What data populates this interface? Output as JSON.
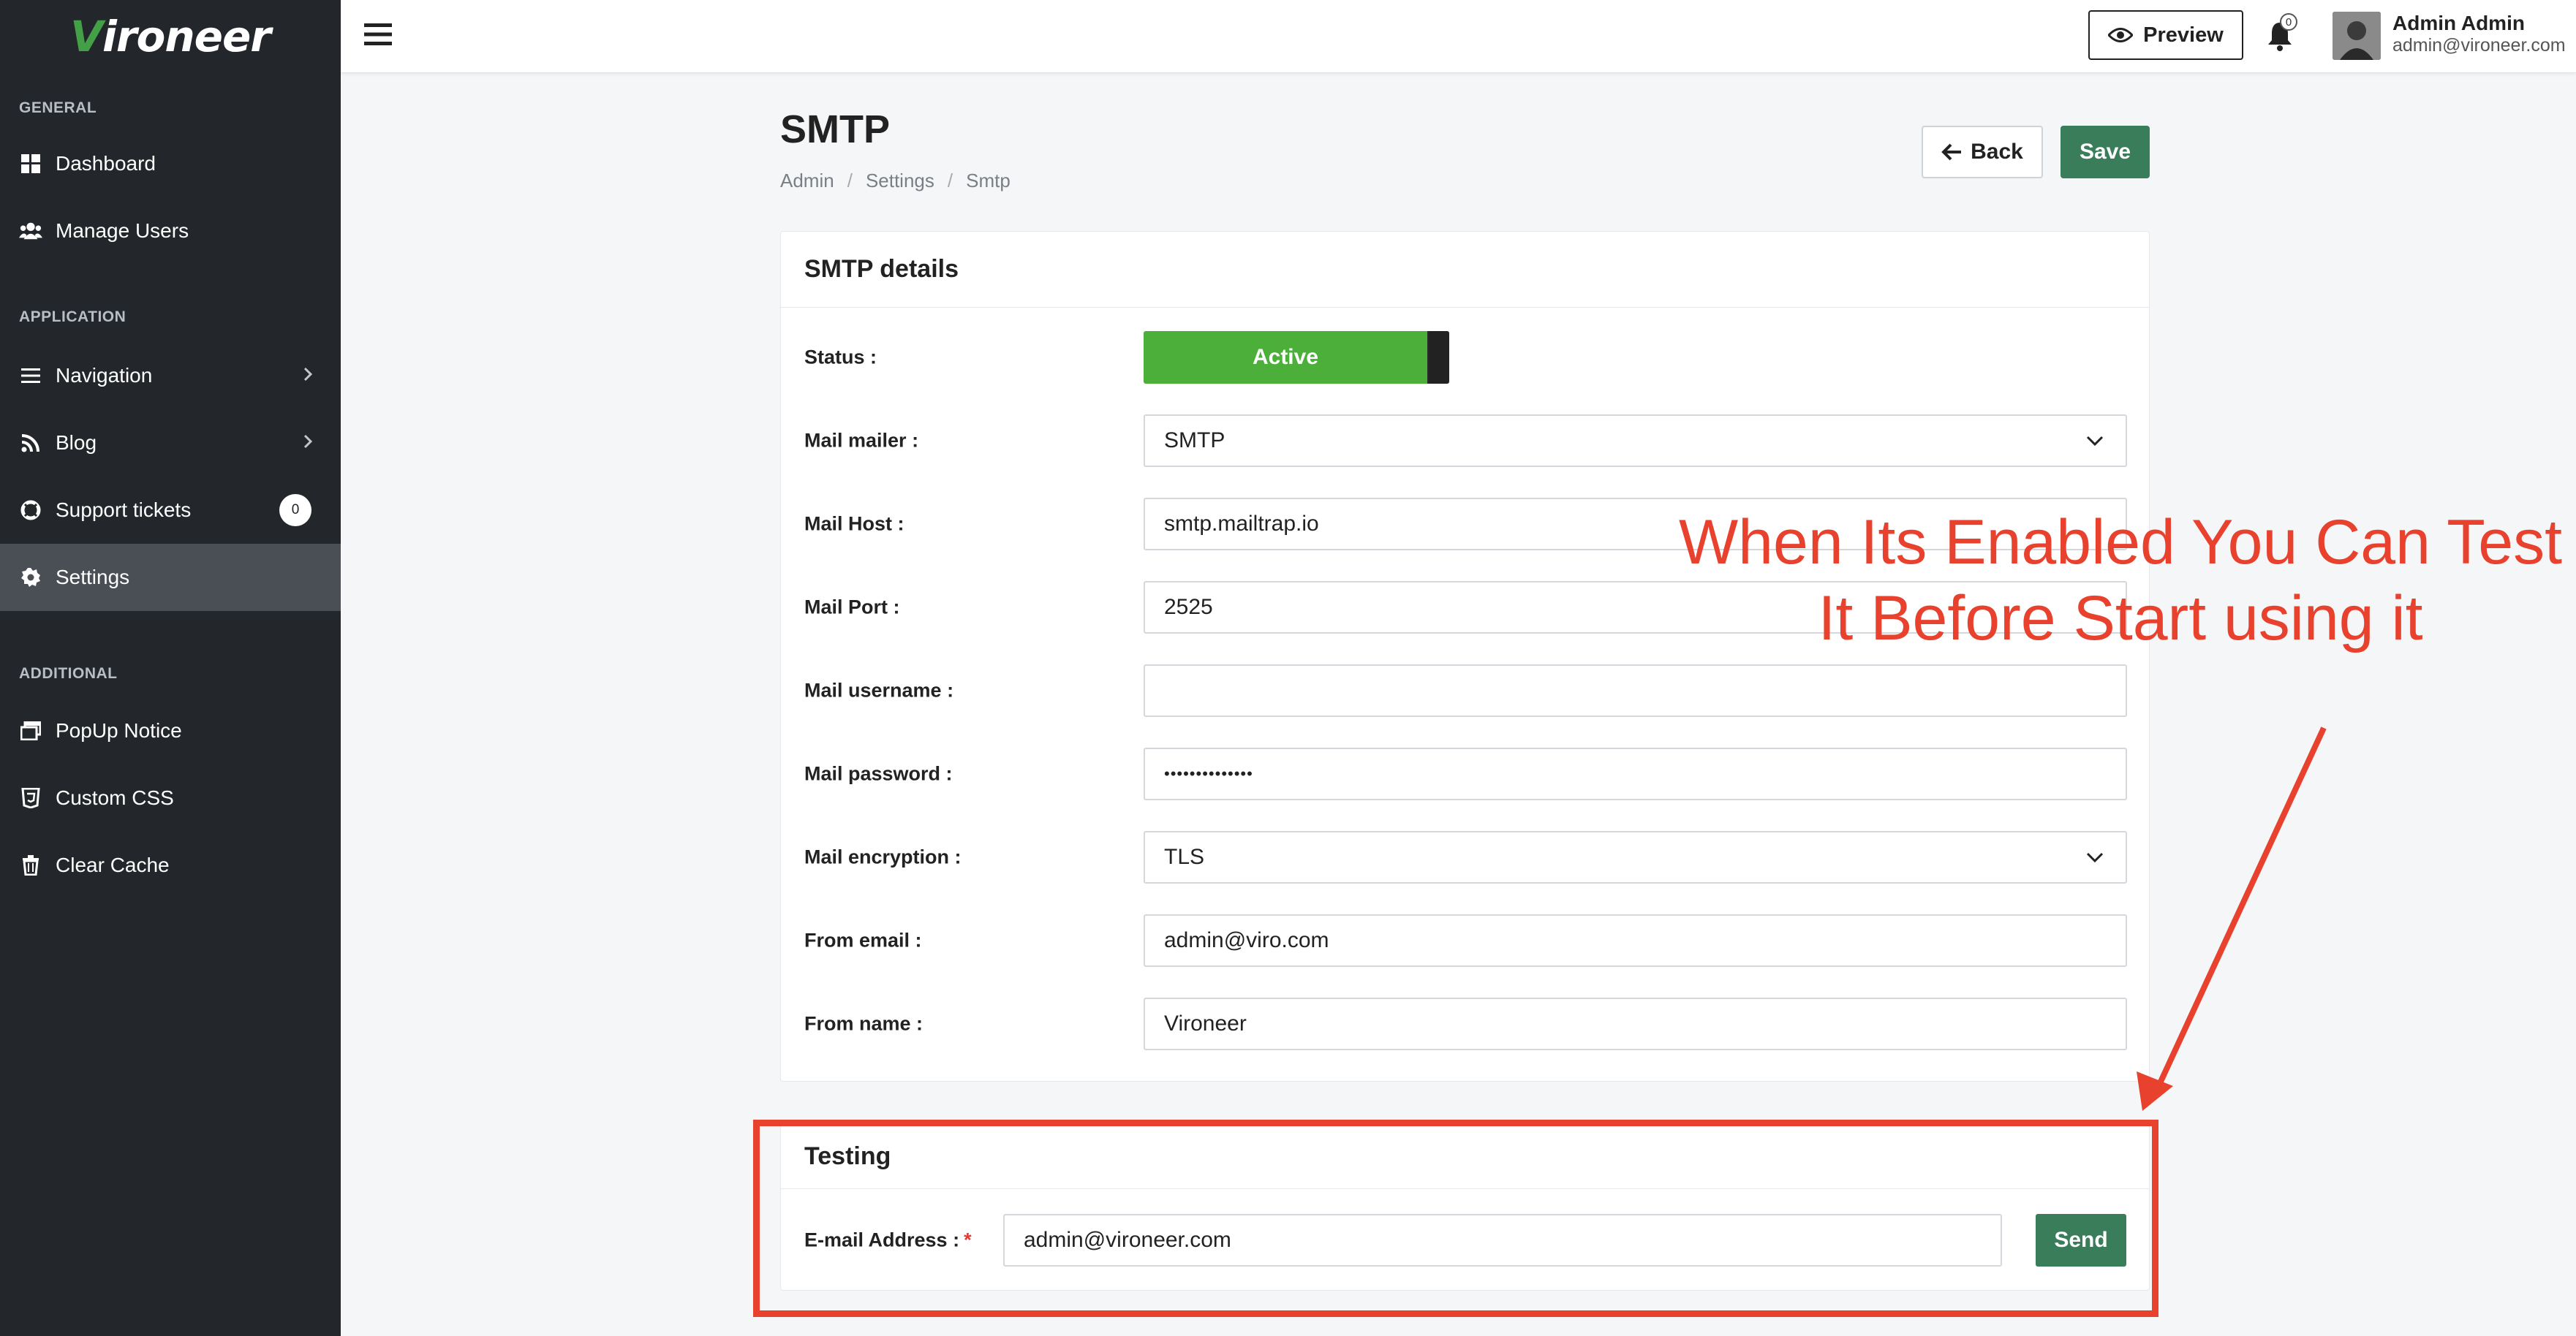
{
  "brand": {
    "logo_prefix": "V",
    "logo_rest": "ironeer"
  },
  "sidebar": {
    "sections": [
      {
        "title": "GENERAL"
      },
      {
        "title": "APPLICATION"
      },
      {
        "title": "ADDITIONAL"
      }
    ],
    "items": [
      {
        "label": "Dashboard",
        "icon": "dashboard-icon"
      },
      {
        "label": "Manage Users",
        "icon": "users-icon"
      },
      {
        "label": "Navigation",
        "icon": "list-icon"
      },
      {
        "label": "Blog",
        "icon": "rss-icon"
      },
      {
        "label": "Support tickets",
        "icon": "lifebuoy-icon",
        "badge": "0"
      },
      {
        "label": "Settings",
        "icon": "gear-icon",
        "active": true
      },
      {
        "label": "PopUp Notice",
        "icon": "window-icon"
      },
      {
        "label": "Custom CSS",
        "icon": "css-icon"
      },
      {
        "label": "Clear Cache",
        "icon": "trash-icon"
      }
    ]
  },
  "topbar": {
    "preview_label": "Preview",
    "notification_count": "0",
    "user_name": "Admin Admin",
    "user_email": "admin@vironeer.com"
  },
  "page": {
    "title": "SMTP",
    "breadcrumb": [
      "Admin",
      "Settings",
      "Smtp"
    ],
    "back_label": "Back",
    "save_label": "Save"
  },
  "smtp_card": {
    "title": "SMTP details",
    "status_label": "Status :",
    "status_value": "Active",
    "fields": [
      {
        "label": "Mail mailer :",
        "value": "SMTP",
        "type": "select"
      },
      {
        "label": "Mail Host :",
        "value": "smtp.mailtrap.io",
        "type": "text"
      },
      {
        "label": "Mail Port :",
        "value": "2525",
        "type": "text"
      },
      {
        "label": "Mail username :",
        "value": "",
        "type": "text"
      },
      {
        "label": "Mail password :",
        "value": "••••••••••••••",
        "type": "password"
      },
      {
        "label": "Mail encryption :",
        "value": "TLS",
        "type": "select"
      },
      {
        "label": "From email :",
        "value": "admin@viro.com",
        "type": "text"
      },
      {
        "label": "From name :",
        "value": "Vironeer",
        "type": "text"
      }
    ]
  },
  "testing_card": {
    "title": "Testing",
    "email_label": "E-mail Address :",
    "required_mark": "*",
    "email_value": "admin@vironeer.com",
    "send_label": "Send"
  },
  "annotation": {
    "line1": "When Its Enabled You Can Test",
    "line2": "It Before Start using it",
    "color": "#e8412e"
  },
  "colors": {
    "sidebar_bg": "#23272b",
    "accent_green": "#3a7d5a",
    "toggle_green": "#4caf39",
    "brand_green": "#43a047"
  }
}
